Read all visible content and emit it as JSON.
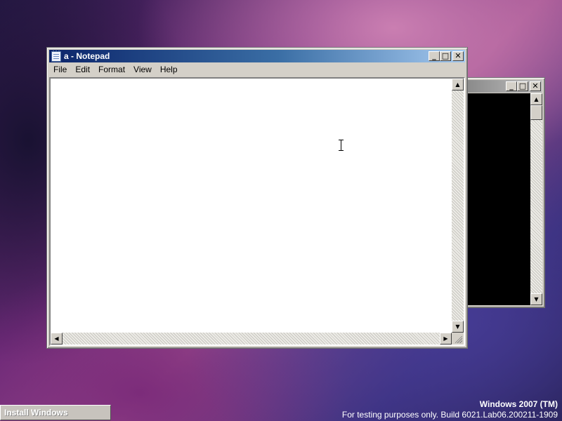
{
  "notepad": {
    "title": "a - Notepad",
    "menu": [
      "File",
      "Edit",
      "Format",
      "View",
      "Help"
    ],
    "content": "",
    "caption_buttons": {
      "minimize": "_",
      "maximize": "□",
      "close": "✕"
    }
  },
  "console": {
    "title": "",
    "caption_buttons": {
      "minimize": "_",
      "maximize": "□",
      "close": "✕"
    }
  },
  "taskbar": {
    "install_label": "Install Windows"
  },
  "watermark": {
    "title": "Windows 2007 (TM)",
    "build": "For testing purposes only. Build 6021.Lab06.200211-1909"
  },
  "scroll_arrows": {
    "up": "▲",
    "down": "▼",
    "left": "◀",
    "right": "▶"
  },
  "colors": {
    "active_title": "#0b246a",
    "inactive_title": "#8a8a8a",
    "console_background": "#000000",
    "window_face": "#d4d0c8"
  },
  "icons": {
    "notepad": "notepad-icon",
    "mouse_cursor": "i-beam-cursor-icon"
  }
}
